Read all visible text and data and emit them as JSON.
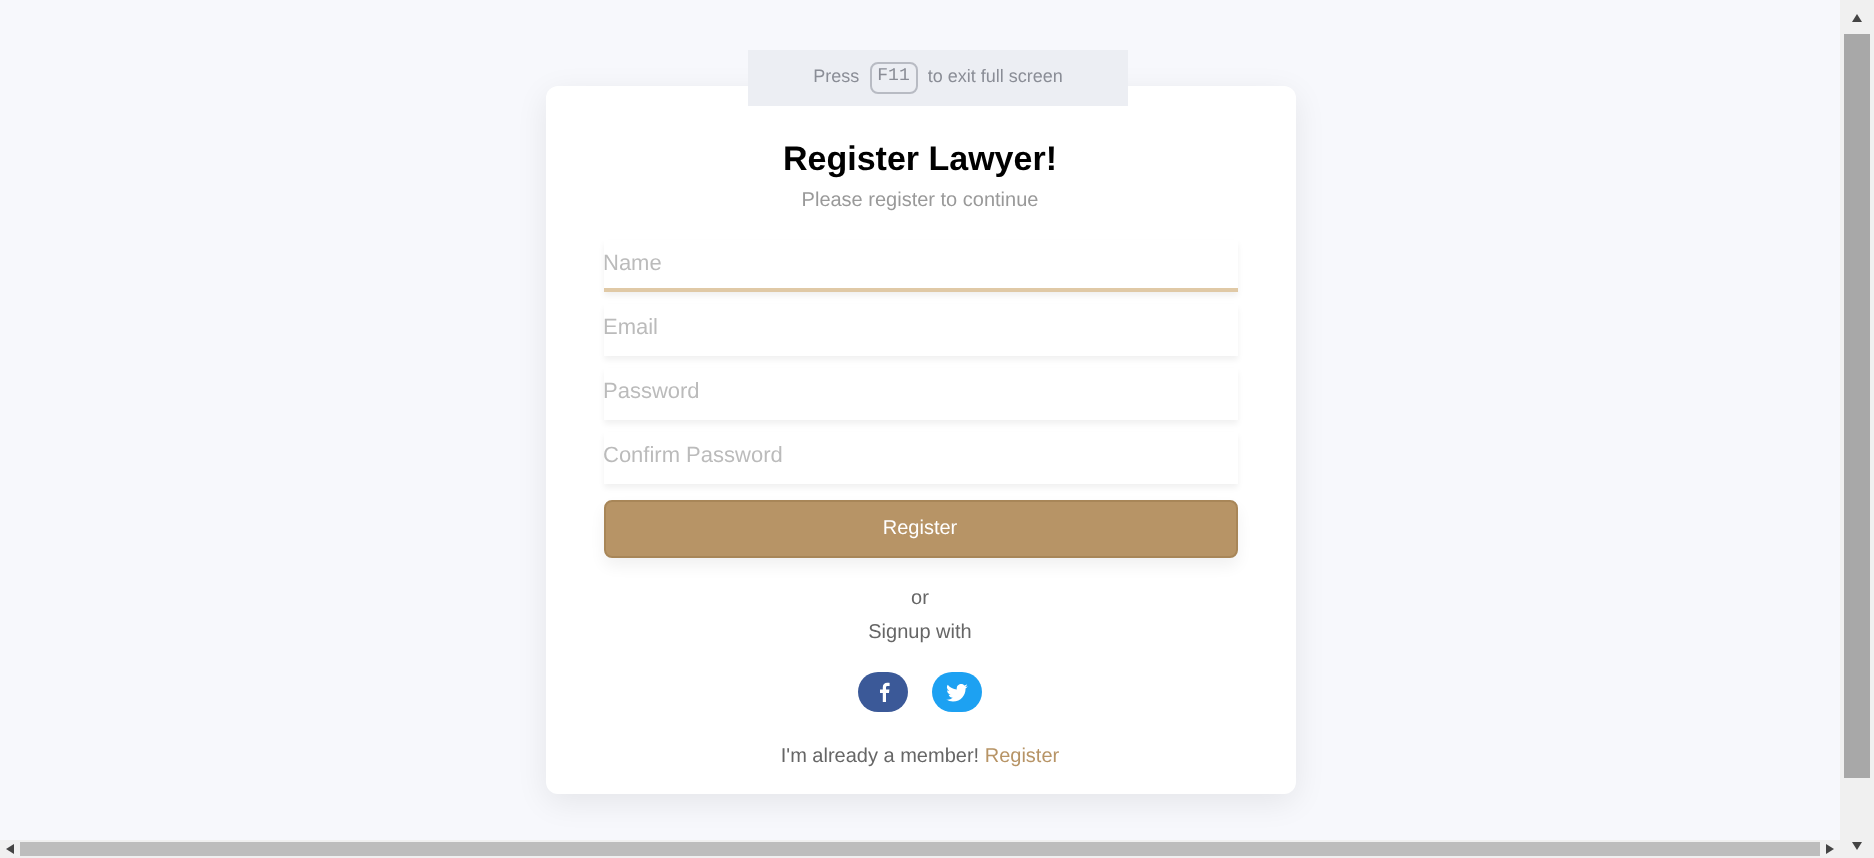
{
  "fullscreen_notice": {
    "prefix": "Press",
    "key": "F11",
    "suffix": "to exit full screen"
  },
  "title": "Register Lawyer!",
  "subtitle": "Please register to continue",
  "fields": [
    {
      "placeholder": "Name",
      "focused": true
    },
    {
      "placeholder": "Email",
      "focused": false
    },
    {
      "placeholder": "Password",
      "focused": false
    },
    {
      "placeholder": "Confirm Password",
      "focused": false
    }
  ],
  "submit": "Register",
  "or": "or",
  "signup_with": "Signup with",
  "social": [
    {
      "kind": "facebook",
      "color": "#3b5998"
    },
    {
      "kind": "twitter",
      "color": "#1da1f2"
    }
  ],
  "footer": {
    "text": "I'm already a member!",
    "link": "Register"
  }
}
